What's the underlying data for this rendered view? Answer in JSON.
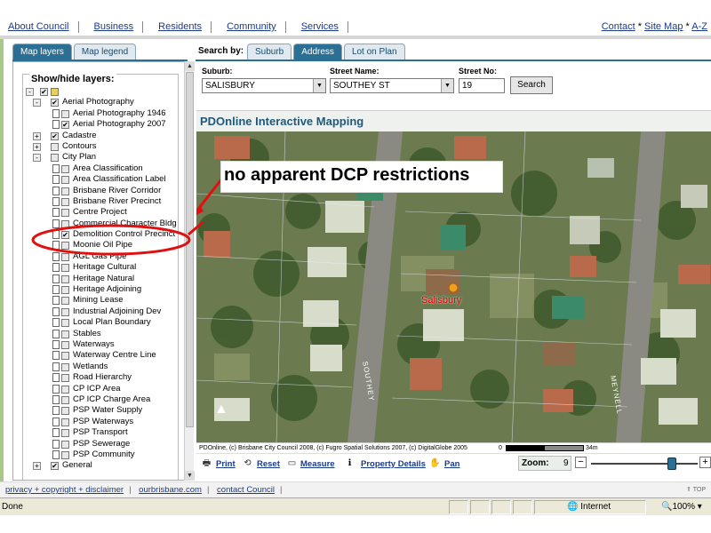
{
  "topnav": {
    "links": [
      "About Council",
      "Business",
      "Residents",
      "Community",
      "Services"
    ],
    "right": {
      "contact": "Contact",
      "sitemap": "Site Map",
      "az": "A-Z"
    }
  },
  "left_tabs": {
    "map_layers": "Map layers",
    "map_legend": "Map legend"
  },
  "layers": {
    "title": "Show/hide layers:",
    "tree": [
      {
        "label": "",
        "level": 0,
        "exp": "-",
        "checked": true,
        "icon": "layers-icon"
      },
      {
        "label": "Aerial Photography",
        "level": 1,
        "exp": "-",
        "checked": true
      },
      {
        "label": "Aerial Photography 1946",
        "level": 2,
        "checked": false
      },
      {
        "label": "Aerial Photography 2007",
        "level": 2,
        "checked": true
      },
      {
        "label": "Cadastre",
        "level": 1,
        "exp": "+",
        "checked": true
      },
      {
        "label": "Contours",
        "level": 1,
        "exp": "+",
        "checked": false
      },
      {
        "label": "City Plan",
        "level": 1,
        "exp": "-",
        "checked": false
      },
      {
        "label": "Area Classification",
        "level": 2,
        "checked": false
      },
      {
        "label": "Area Classification Label",
        "level": 2,
        "checked": false
      },
      {
        "label": "Brisbane River Corridor",
        "level": 2,
        "checked": false
      },
      {
        "label": "Brisbane River Precinct",
        "level": 2,
        "checked": false
      },
      {
        "label": "Centre Project",
        "level": 2,
        "checked": false
      },
      {
        "label": "Commercial Character Bldg",
        "level": 2,
        "checked": false
      },
      {
        "label": "Demolition Control Precinct",
        "level": 2,
        "checked": true
      },
      {
        "label": "Moonie Oil Pipe",
        "level": 2,
        "checked": false
      },
      {
        "label": "AGL Gas Pipe",
        "level": 2,
        "checked": false
      },
      {
        "label": "Heritage Cultural",
        "level": 2,
        "checked": false
      },
      {
        "label": "Heritage Natural",
        "level": 2,
        "checked": false
      },
      {
        "label": "Heritage Adjoining",
        "level": 2,
        "checked": false
      },
      {
        "label": "Mining Lease",
        "level": 2,
        "checked": false
      },
      {
        "label": "Industrial Adjoining Dev",
        "level": 2,
        "checked": false
      },
      {
        "label": "Local Plan Boundary",
        "level": 2,
        "checked": false
      },
      {
        "label": "Stables",
        "level": 2,
        "checked": false
      },
      {
        "label": "Waterways",
        "level": 2,
        "checked": false
      },
      {
        "label": "Waterway Centre Line",
        "level": 2,
        "checked": false
      },
      {
        "label": "Wetlands",
        "level": 2,
        "checked": false
      },
      {
        "label": "Road Hierarchy",
        "level": 2,
        "checked": false
      },
      {
        "label": "CP ICP Area",
        "level": 2,
        "checked": false
      },
      {
        "label": "CP ICP Charge Area",
        "level": 2,
        "checked": false
      },
      {
        "label": "PSP Water Supply",
        "level": 2,
        "checked": false
      },
      {
        "label": "PSP Waterways",
        "level": 2,
        "checked": false
      },
      {
        "label": "PSP Transport",
        "level": 2,
        "checked": false
      },
      {
        "label": "PSP Sewerage",
        "level": 2,
        "checked": false
      },
      {
        "label": "PSP Community",
        "level": 2,
        "checked": false
      },
      {
        "label": "General",
        "level": 1,
        "exp": "+",
        "checked": true
      }
    ]
  },
  "search": {
    "label": "Search by:",
    "tabs": {
      "suburb": "Suburb",
      "address": "Address",
      "lot_on_plan": "Lot on Plan"
    },
    "suburb_label": "Suburb:",
    "suburb_value": "SALISBURY",
    "street_label": "Street Name:",
    "street_value": "SOUTHEY ST",
    "street_no_label": "Street No:",
    "street_no_value": "19",
    "button": "Search"
  },
  "map": {
    "title": "PDOnline Interactive Mapping",
    "annotation": "no apparent DCP restrictions",
    "place": "Salisbury",
    "street1": "SOUTHEY",
    "street2": "MEYNELL",
    "credits": "PDOnline, (c) Brisbane City Council 2008, (c) Fugro Spatial Solutions 2007, (c) DigitalGlobe 2005",
    "scale_start": "0",
    "scale_end": "34m"
  },
  "toolbar": {
    "print": "Print",
    "reset": "Reset",
    "measure": "Measure",
    "property_details": "Property Details",
    "pan": "Pan",
    "zoom_label": "Zoom:",
    "zoom_value": "9",
    "zoom_level_fraction": 0.76
  },
  "footer": {
    "privacy": "privacy + copyright + disclaimer",
    "ourbrisbane": "ourbrisbane.com",
    "contact": "contact Council",
    "top": "TOP"
  },
  "status": {
    "done": "Done",
    "zone": "Internet",
    "zoom": "100%"
  },
  "colors": {
    "accent": "#2c6f95",
    "link": "#1a3a8a",
    "annotation_red": "#e01010"
  }
}
